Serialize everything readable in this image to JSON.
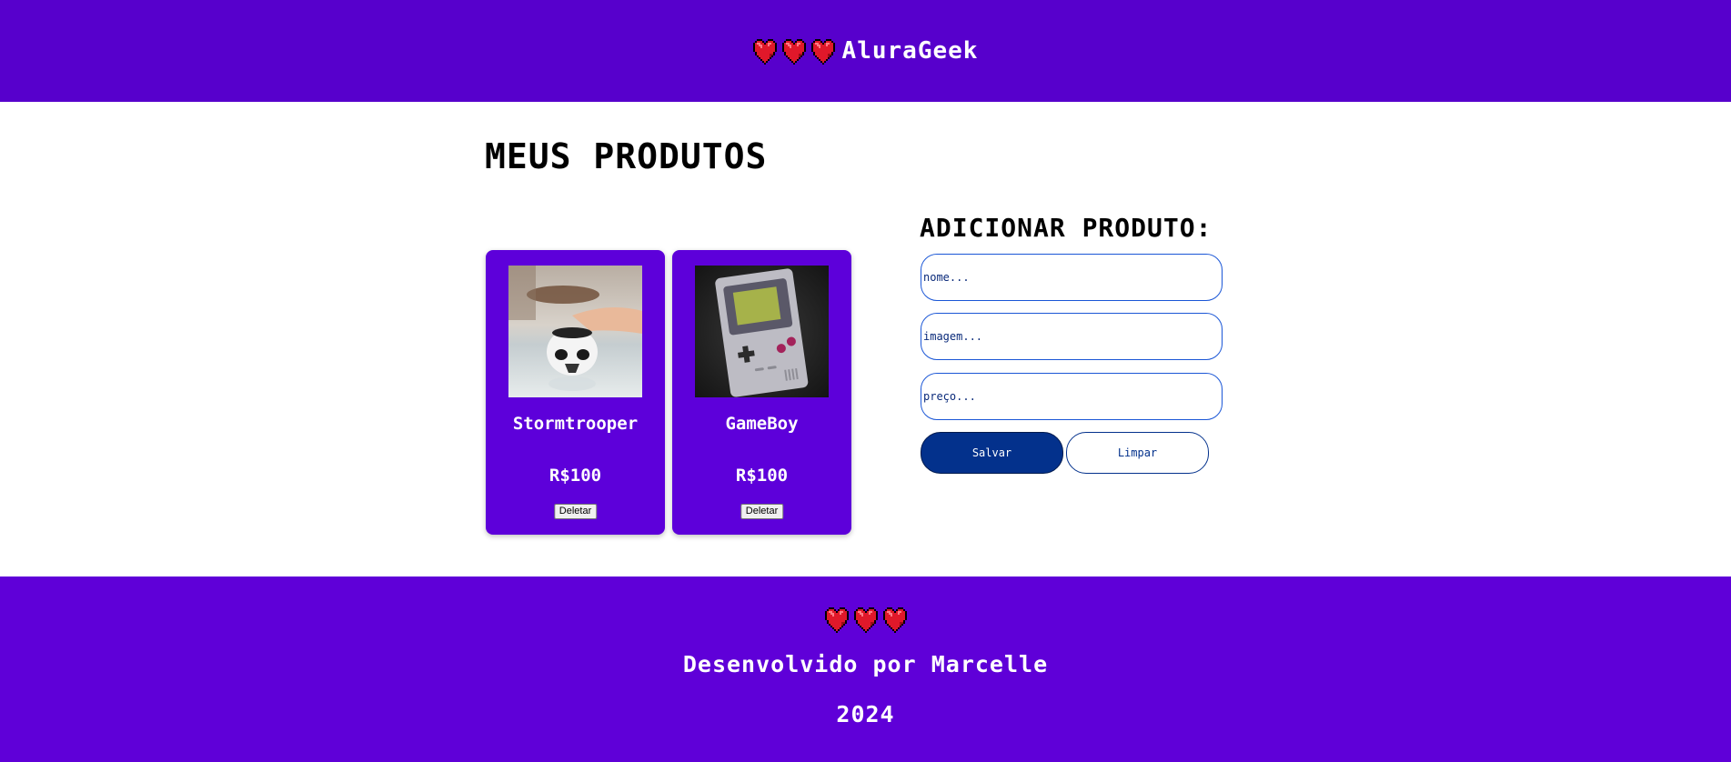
{
  "header": {
    "logo_text": "AluraGeek",
    "hearts": [
      "heart-icon",
      "heart-icon",
      "heart-icon"
    ]
  },
  "main": {
    "title": "MEUS PRODUTOS"
  },
  "products": [
    {
      "name": "Stormtrooper",
      "price": "R$100",
      "delete_label": "Deletar",
      "image_icon": "stormtrooper-image"
    },
    {
      "name": "GameBoy",
      "price": "R$100",
      "delete_label": "Deletar",
      "image_icon": "gameboy-image"
    }
  ],
  "form": {
    "title": "ADICIONAR PRODUTO:",
    "name_placeholder": "nome...",
    "image_placeholder": "imagem...",
    "price_placeholder": "preço...",
    "save_label": "Salvar",
    "clear_label": "Limpar"
  },
  "footer": {
    "credit": "Desenvolvido por Marcelle",
    "year": "2024"
  },
  "colors": {
    "header_bg": "#5700cc",
    "card_bg": "#5d00da",
    "footer_bg": "#5f00d8",
    "primary_button": "#03318c",
    "input_border": "#1a56d6",
    "heart": "#e0182a"
  }
}
